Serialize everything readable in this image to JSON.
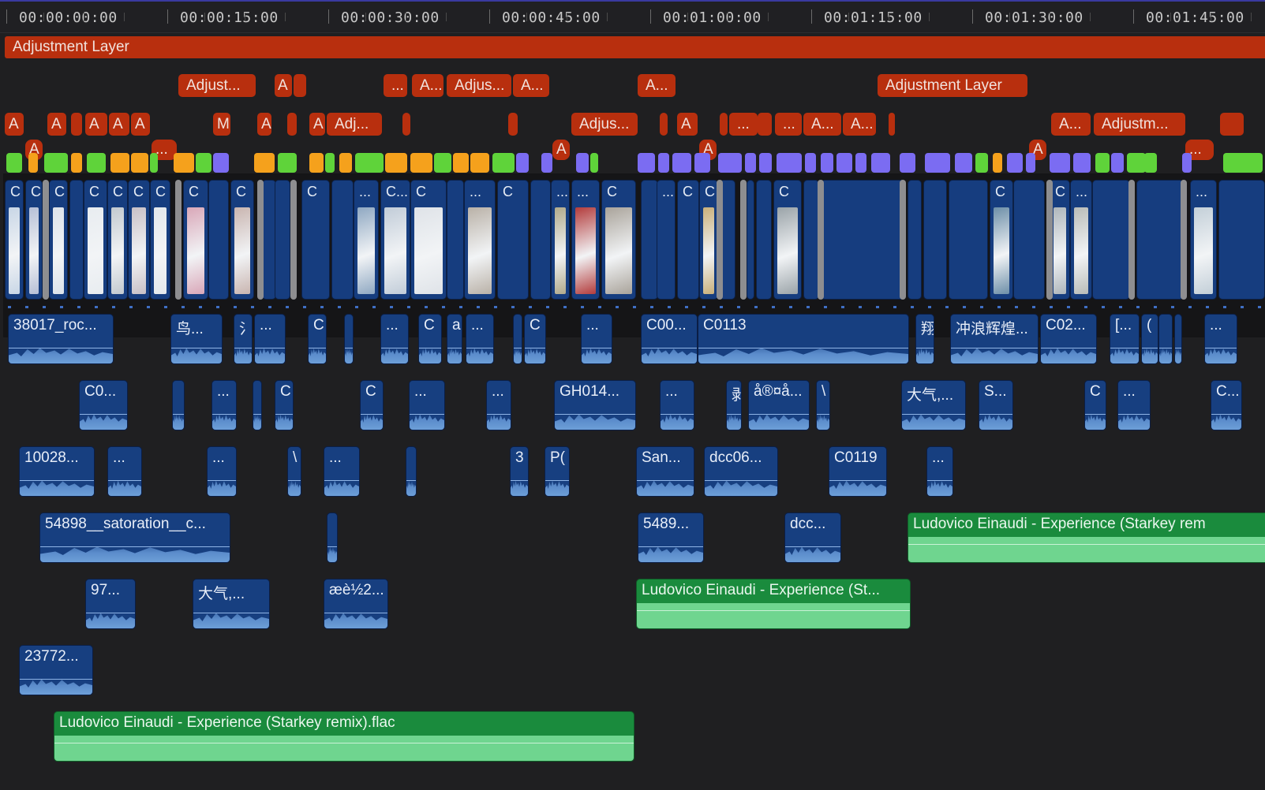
{
  "ruler": {
    "labels": [
      "00:00:00:00",
      "00:00:15:00",
      "00:00:30:00",
      "00:00:45:00",
      "00:01:00:00",
      "00:01:15:00",
      "00:01:30:00",
      "00:01:45:00"
    ]
  },
  "adjustment": {
    "full_label": "Adjustment Layer",
    "row2": [
      "Adjust...",
      "A",
      "...",
      "A...",
      "Adjus...",
      "A...",
      "A...",
      "Adjustment Layer"
    ],
    "row3": [
      "A",
      "A",
      "A",
      "A",
      "A",
      "M",
      "A",
      "A",
      "Adj...",
      "Adjus...",
      "A",
      "...",
      "...",
      "A...",
      "A...",
      "A...",
      "Adjustm..."
    ],
    "markers": [
      "A",
      "A",
      "A",
      "A",
      "..."
    ]
  },
  "storyline": {
    "titles": [
      "C",
      "C",
      "C",
      "C",
      "C",
      "C",
      "C",
      "C",
      "...",
      "C",
      "C",
      "...",
      "C...",
      "C",
      "...",
      "C",
      "...",
      "...",
      "C",
      "...",
      "C",
      "C",
      "C",
      "C",
      "C",
      "..."
    ]
  },
  "audio": {
    "row1": [
      "38017_roc...",
      "鸟...",
      "氵",
      "...",
      "C",
      "...",
      "C",
      "a",
      "...",
      "C",
      "...",
      "C00...",
      "C0113",
      "翔",
      "冲浪辉煌...",
      "C02...",
      "[...",
      "(",
      "..."
    ],
    "row2": [
      "C0...",
      "...",
      "C",
      "C",
      "...",
      "...",
      "GH014...",
      "...",
      "剥",
      "å®¤å...",
      "\\",
      "大气,...",
      "S...",
      "C",
      "...",
      "C..."
    ],
    "row3": [
      "10028...",
      "...",
      "...",
      "\\",
      "...",
      "3",
      "P(",
      "San...",
      "dcc06...",
      "C0119",
      "..."
    ],
    "row4": [
      "54898__satoration__c...",
      "5489...",
      "dcc..."
    ],
    "row4_music": "Ludovico Einaudi - Experience (Starkey rem",
    "row5": [
      "97...",
      "大气,...",
      "æè½2..."
    ],
    "row5_music": "Ludovico Einaudi - Experience (St...",
    "row6": [
      "23772..."
    ],
    "row7_music": "Ludovico Einaudi - Experience (Starkey remix).flac"
  },
  "colors": {
    "adjustment": "#b82f0e",
    "video": "#163d7f",
    "music": "#1a8b3d",
    "connected_green": "#5fd33a",
    "connected_orange": "#f5a11c",
    "connected_purple": "#7b6cf2"
  }
}
